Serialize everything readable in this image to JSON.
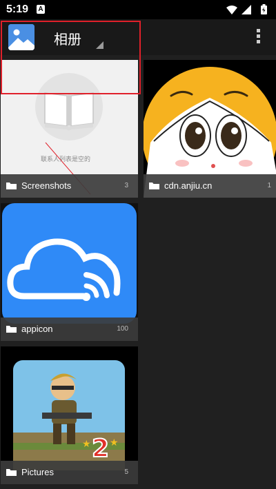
{
  "status_bar": {
    "time": "5:19",
    "notification_letter": "A"
  },
  "action_bar": {
    "title": "相册"
  },
  "albums": [
    {
      "name": "Screenshots",
      "count": "3",
      "thumb_caption": "联系人列表是空的"
    },
    {
      "name": "cdn.anjiu.cn",
      "count": "1"
    },
    {
      "name": "appicon",
      "count": "100"
    },
    {
      "name": "Pictures",
      "count": "5"
    }
  ],
  "icons": {
    "app": "gallery-app-icon",
    "menu": "overflow-menu-icon",
    "folder": "folder-icon",
    "wifi": "wifi-icon",
    "signal": "signal-icon",
    "battery": "battery-charging-icon"
  },
  "colors": {
    "highlight": "#e0202a",
    "accent": "#2f8af7"
  }
}
